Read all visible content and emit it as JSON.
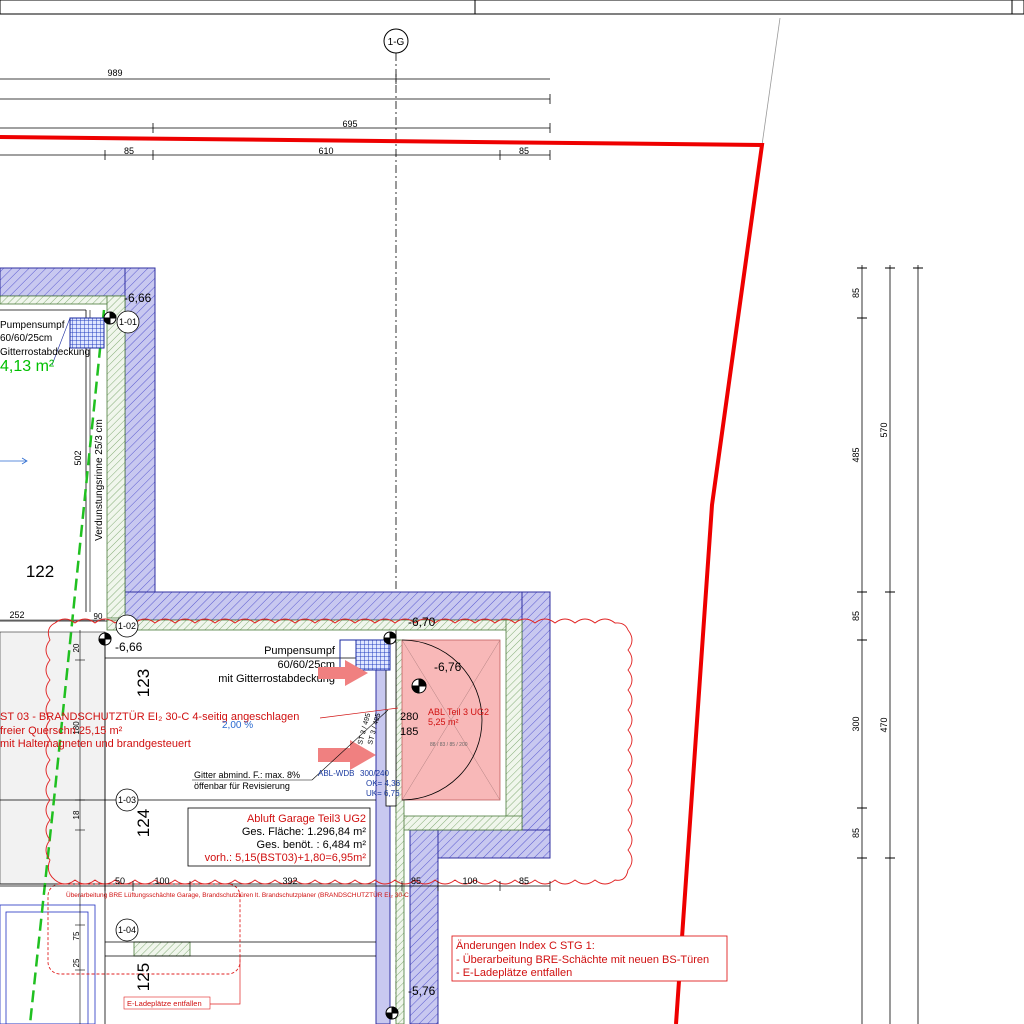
{
  "grid": {
    "axis_label": "1-G",
    "tags": [
      "1-01",
      "1-02",
      "1-03",
      "1-04"
    ]
  },
  "dims_top": {
    "d989": "989",
    "d695": "695",
    "d85a": "85",
    "d610": "610",
    "d85b": "85"
  },
  "dims_right": [
    "85",
    "485",
    "85",
    "300",
    "85",
    "570",
    "470"
  ],
  "dims_bottom": [
    "50",
    "100",
    "392",
    "85",
    "100",
    "85"
  ],
  "dims_left": {
    "d502": "502",
    "d252": "252",
    "d90": "90",
    "d20": "20",
    "d180": "180",
    "d18": "18",
    "d75": "75",
    "d25": "25"
  },
  "levels": {
    "l1": "-6,66",
    "l2": "-6,66",
    "l3": "-6,70",
    "l4": "-6,76",
    "l5": "-5,76"
  },
  "rooms": {
    "r122": "122",
    "r123": "123",
    "r124": "124",
    "r125": "125"
  },
  "sump_left": {
    "l1": "Pumpensumpf",
    "l2": "60/60/25cm",
    "l3": "Gitterrostabdeckung",
    "area": "4,13 m²"
  },
  "sump_center": {
    "l1": "Pumpensumpf",
    "l2": "60/60/25cm",
    "l3": "mit Gitterrostabdeckung"
  },
  "gutter": "Verdunstungsrinne 25/3 cm",
  "fire_door": {
    "l1": "ST 03 - BRANDSCHUTZTÜR EI₂ 30-C 4-seitig angeschlagen",
    "l2": "freier Querschn 25,15 m²",
    "l3": "mit Haltemagneten und brandgesteuert",
    "pct": "2,00 %"
  },
  "grid_note": {
    "l1": "Gitter abmind. F.: max. 8%",
    "l2": "öffenbar für Revisierung"
  },
  "duct": {
    "name": "ABL-WDB",
    "size": "300/240",
    "ok": "OK= 4,36",
    "uk": "UK= 6,76",
    "v1": "ST 3 / 495",
    "v2": "ST 3 / 495"
  },
  "shaft": {
    "d280": "280",
    "d185": "185",
    "label": "ABL Teil 3 UG2",
    "area": "5,25 m²",
    "door": "88 / 83 / 85 / 200"
  },
  "exhaust": {
    "title": "Abluft Garage Teil3 UG2",
    "l1": "Ges. Fläche: 1.296,84 m²",
    "l2": "Ges. benöt. : 6,484 m²",
    "l3": "vorh.: 5,15(BST03)+1,80=6,95m²"
  },
  "rev_note": "Überarbeitung BRE Lüftungsschächte Garage, Brandschutztüren lt. Brandschutzplaner (BRANDSCHUTZTÜR EI₂ 30-C",
  "changes": {
    "title": "Änderungen Index C STG 1:",
    "l1": "- Überarbeitung BRE-Schächte mit neuen BS-Türen",
    "l2": "- E-Ladeplätze entfallen"
  },
  "ev_note": "E-Ladeplätze entfallen",
  "colors": {
    "boundary": "#ee0000",
    "wall_fill": "#c8c8f0",
    "wall_line": "#3030a0",
    "shaft_fill": "#f8b8b8",
    "revision": "#e02020",
    "area_text": "#00c000",
    "note_text": "#d01010"
  }
}
